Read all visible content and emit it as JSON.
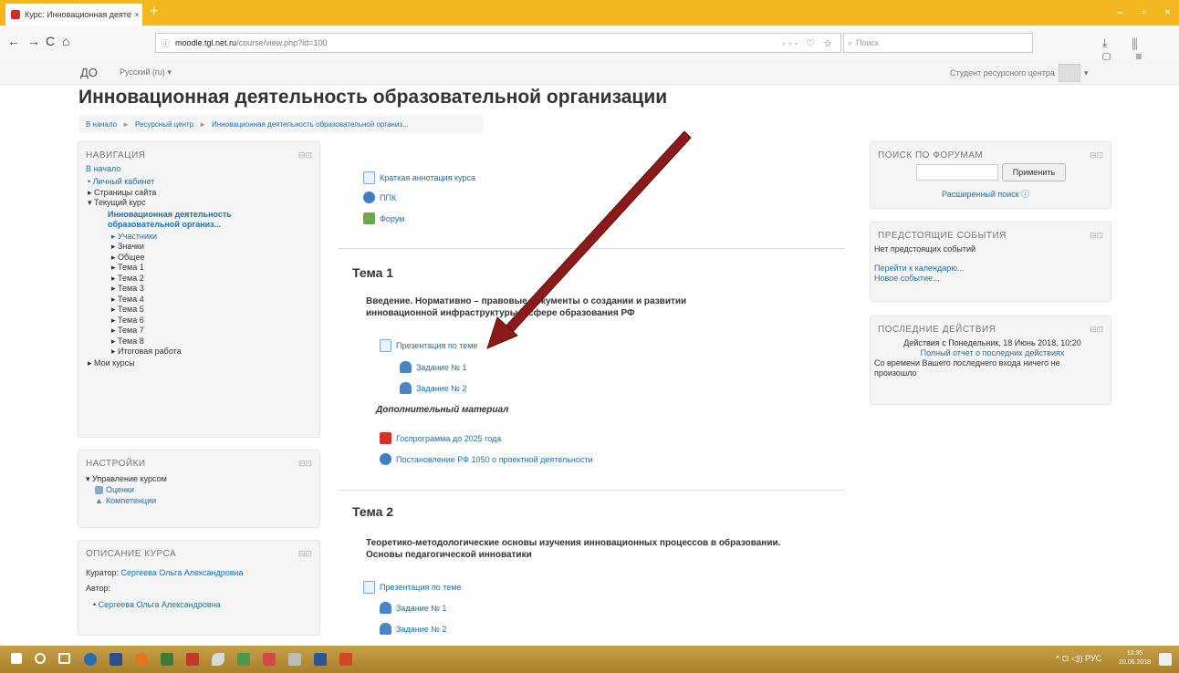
{
  "browser": {
    "tab_title": "Курс: Инновационная деятел...",
    "tab_close": "×",
    "new_tab": "+",
    "url_info": "ⓘ",
    "url_host": "moodle.tgl.net.ru",
    "url_path": "/course/view.php?id=100",
    "url_tools": "··· ♡ ☆",
    "search_placeholder": "Поиск",
    "back": "←",
    "forward": "→",
    "reload": "C",
    "home": "⌂",
    "right_tools": "⤓ ⫼ ▢ ≡",
    "minimize": "–",
    "maximize": "▫",
    "close": "×"
  },
  "header": {
    "brand": "ДО",
    "language": "Русский (ru) ▾",
    "user": "Студент ресурсного центра",
    "user_caret": "▾"
  },
  "page_title": "Инновационная деятельность образовательной организации",
  "breadcrumb": [
    "В начало",
    "Ресурсный центр",
    "Инновационная деятельность образовательной организ..."
  ],
  "breadcrumb_sep": "►",
  "navigation": {
    "title": "НАВИГАЦИЯ",
    "home": "В начало",
    "items": [
      "• Личный кабинет",
      "▸ Страницы сайта",
      "▾ Текущий курс"
    ],
    "course_line1": "Инновационная деятельность",
    "course_line2": "образовательной организ...",
    "course_items": [
      "▸ Участники",
      "▸ Значки",
      "▸ Общее",
      "▸ Тема 1",
      "▸ Тема 2",
      "▸ Тема 3",
      "▸ Тема 4",
      "▸ Тема 5",
      "▸ Тема 6",
      "▸ Тема 7",
      "▸ Тема 8",
      "▸ Итоговая работа"
    ],
    "my_courses": "▸ Мои курсы"
  },
  "settings": {
    "title": "НАСТРОЙКИ",
    "manage": "▾ Управление курсом",
    "grades": "Оценки",
    "competencies": "Компетенции"
  },
  "description": {
    "title": "ОПИСАНИЕ КУРСА",
    "curator_label": "Куратор:",
    "curator": "Сергеева Ольга Александровна",
    "author_label": "Автор:",
    "author": "Сергеева Ольга Александровна"
  },
  "block_controls": "⊟⊡",
  "general_section": {
    "items": [
      "Краткая аннотация курса",
      "ППК",
      "Форум"
    ]
  },
  "topic1": {
    "title": "Тема 1",
    "summary_line1": "Введение. Нормативно – правовые документы  о создании и развитии",
    "summary_line2": "инновационной инфраструктуры в сфере образования РФ",
    "presentation": "Презентация по теме",
    "task1": "Задание № 1",
    "task2": "Задание № 2",
    "extra_heading": "Дополнительный материал",
    "extra1": "Госпрограмма до 2025 года",
    "extra2": "Постановление РФ 1050 о проектной деятельности"
  },
  "topic2": {
    "title": "Тема 2",
    "summary_line1": "Теоретико-методологические основы изучения инновационных процессов в образовании.",
    "summary_line2": "Основы педагогической инноватики",
    "presentation": "Презентация по теме",
    "task1": "Задание № 1",
    "task2": "Задание № 2"
  },
  "forum_search": {
    "title": "ПОИСК ПО ФОРУМАМ",
    "button": "Применить",
    "advanced": "Расширенный поиск ⓘ"
  },
  "upcoming": {
    "title": "ПРЕДСТОЯЩИЕ СОБЫТИЯ",
    "none": "Нет предстоящих событий",
    "calendar": "Перейти к календарю...",
    "new_event": "Новое событие..."
  },
  "recent": {
    "title": "ПОСЛЕДНИЕ ДЕЙСТВИЯ",
    "since": "Действия с Понедельник, 18 Июнь 2018, 10:20",
    "full_report": "Полный отчет о последних действиях",
    "nothing_line1": "Со времени Вашего последнего входа ничего не",
    "nothing_line2": "произошло"
  },
  "taskbar": {
    "tray": "^ ⊡ ◁)) РУС",
    "time": "10:35",
    "date": "20.06.2018"
  },
  "colors": {
    "titlebar": "#f3b71f",
    "link": "#1a6fb5",
    "arrow": "#8b1a1a",
    "taskbar": "#b8902f"
  }
}
